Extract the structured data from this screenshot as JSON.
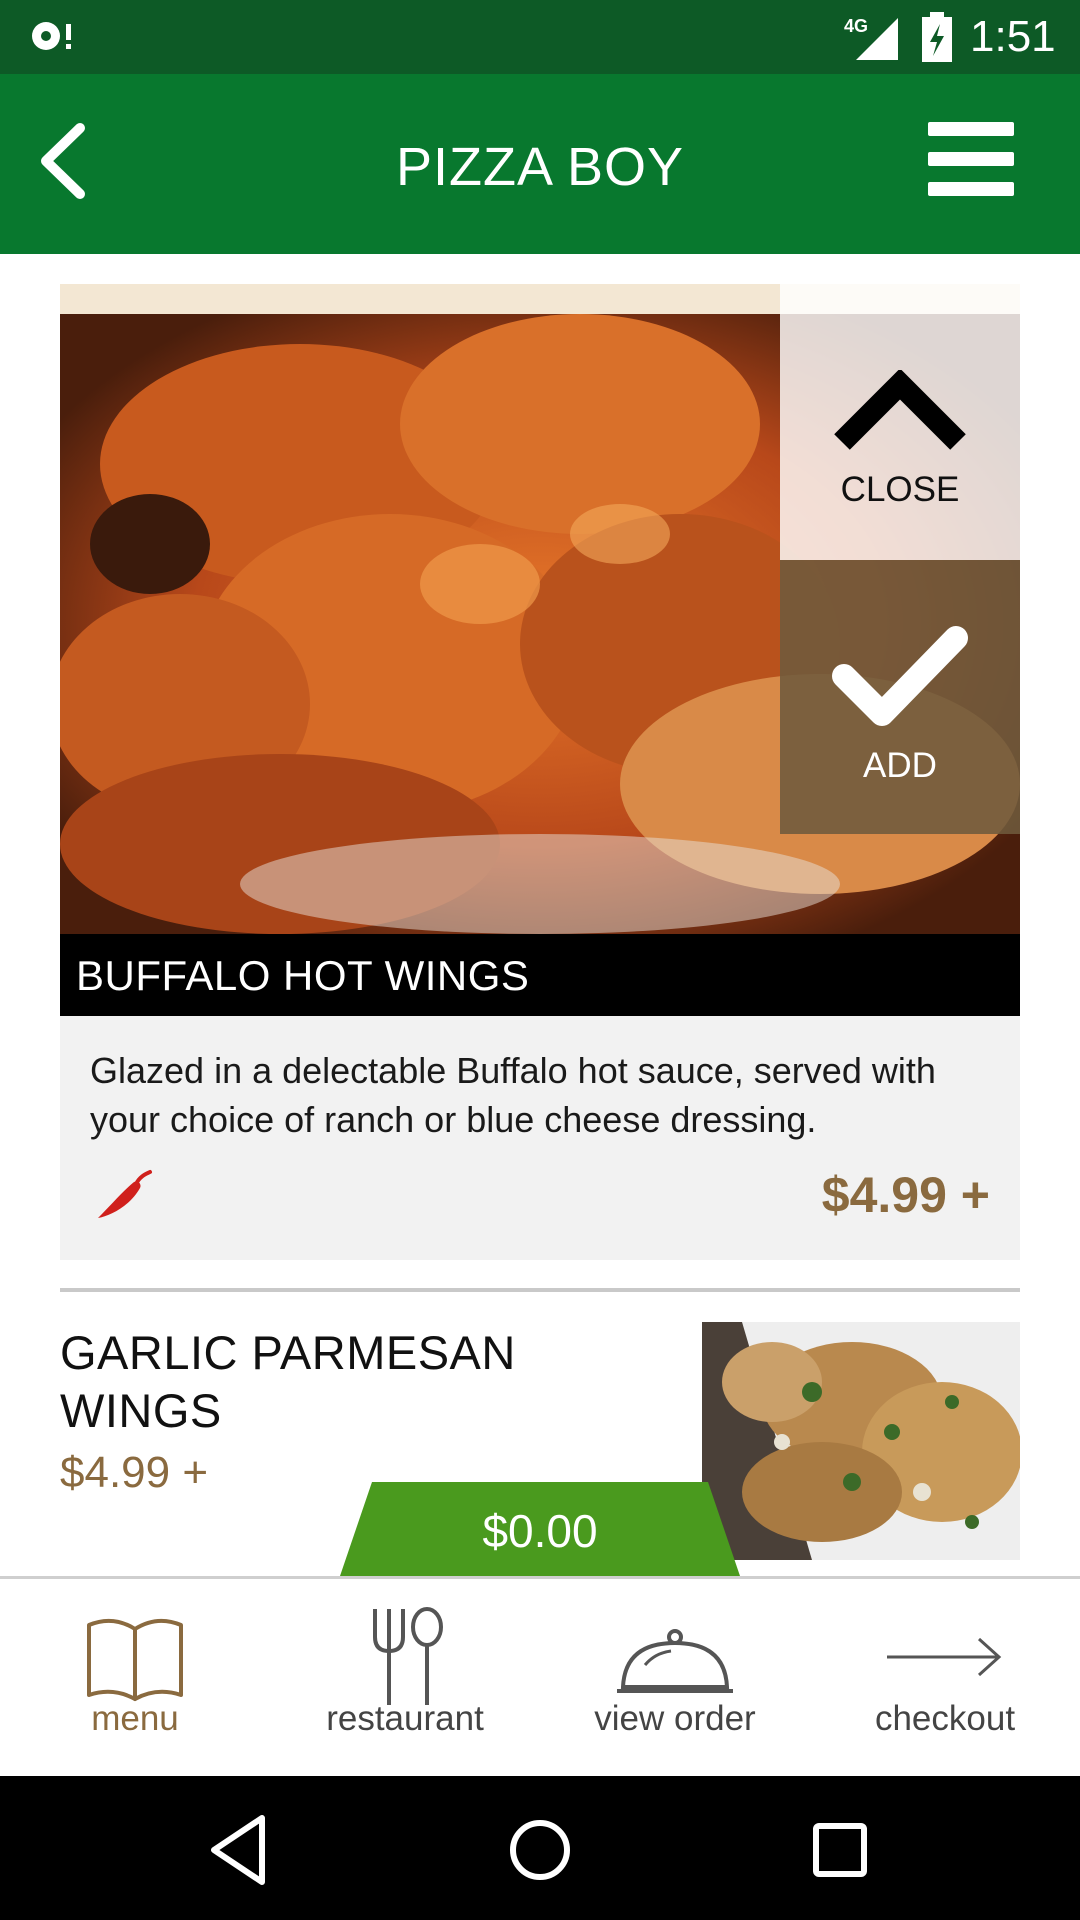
{
  "status_bar": {
    "time": "1:51",
    "network": "4G"
  },
  "app_bar": {
    "title": "PIZZA BOY"
  },
  "featured_item": {
    "name": "BUFFALO HOT WINGS",
    "description": "Glazed in a delectable Buffalo hot sauce, served with your choice of ranch or blue cheese dressing.",
    "price": "$4.99 +",
    "close_label": "CLOSE",
    "add_label": "ADD",
    "spicy_icon": "chili-pepper-icon"
  },
  "next_item": {
    "name": "GARLIC PARMESAN WINGS",
    "price": "$4.99 +"
  },
  "cart": {
    "total": "$0.00"
  },
  "bottom_nav": {
    "items": [
      {
        "label": "menu",
        "icon": "book-icon",
        "active": true
      },
      {
        "label": "restaurant",
        "icon": "fork-spoon-icon",
        "active": false
      },
      {
        "label": "view order",
        "icon": "cloche-icon",
        "active": false
      },
      {
        "label": "checkout",
        "icon": "arrow-right-icon",
        "active": false
      }
    ]
  },
  "colors": {
    "status_bar": "#0d5a26",
    "app_bar": "#08782e",
    "accent_brown": "#8a6a3f",
    "cart_green": "#4a9a1e"
  }
}
